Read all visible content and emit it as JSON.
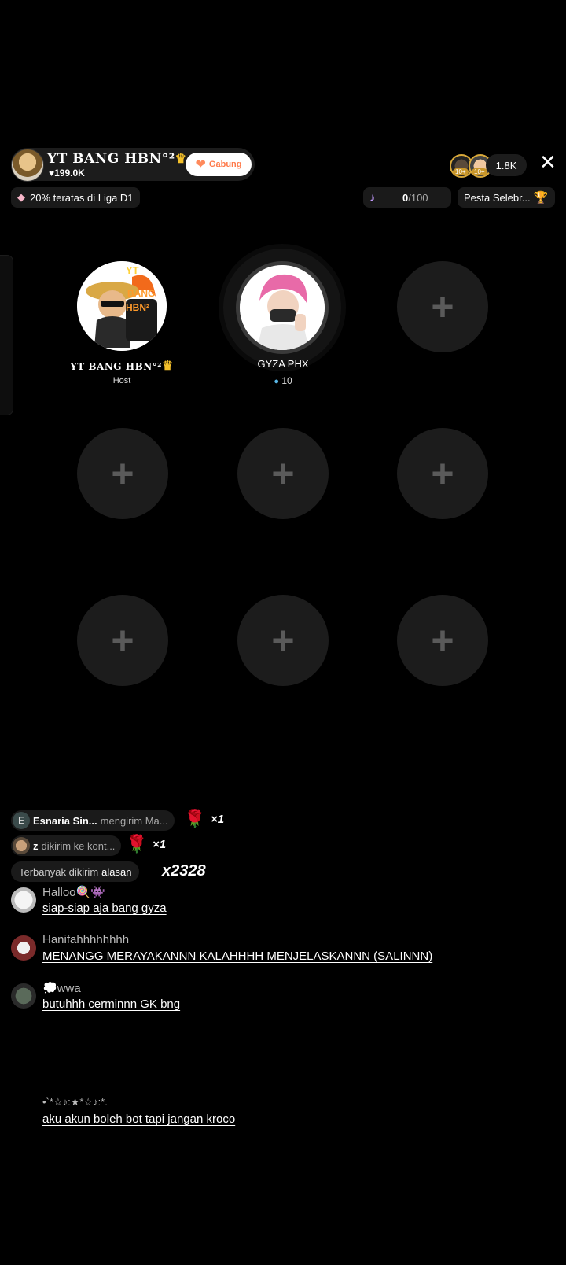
{
  "host_bar": {
    "name": "YT BANG HBN°²",
    "likes": "♥199.0K",
    "join_label": "Gabung",
    "viewer_count": "1.8K",
    "viewer_badge_1": "10+",
    "viewer_badge_2": "10+"
  },
  "league": {
    "text": "20% teratas di Liga D1"
  },
  "score": {
    "current": "0",
    "max": "/100"
  },
  "event": {
    "label": "Pesta Selebr..."
  },
  "seats": {
    "host": {
      "name": "YT BANG HBN°²",
      "role": "Host",
      "badge_line1": "YT",
      "badge_line2": "BANG",
      "badge_line3": "HBN²"
    },
    "guest": {
      "name": "GYZA PHX",
      "coins": "10"
    }
  },
  "gifts": [
    {
      "avatar_letter": "E",
      "user": "Esnaria Sin...",
      "action": "mengirim Ma...",
      "count": "×1"
    },
    {
      "user": "z",
      "action": "dikirim ke kont...",
      "count": "×1"
    }
  ],
  "top_sent": {
    "label": "Terbanyak dikirim",
    "reason": "alasan",
    "count": "x2328"
  },
  "comments": [
    {
      "user": "Halloo🍭👾",
      "text": "siap-siap aja bang gyza"
    },
    {
      "user": "Hanifahhhhhhhh",
      "text": "MENANGG MERAYAKANNN KALAHHHH MENJELASKANNN (SALINNN)"
    },
    {
      "user": "💭wwa",
      "text": "butuhhh cerminnn GK bng"
    },
    {
      "user": "•`*☆♪:★*☆♪:*.",
      "text": "aku akun boleh bot tapi jangan kroco"
    }
  ],
  "colors": {
    "background": "#000000",
    "accent_join": "#ff7a4a",
    "coin": "#5ab8e8",
    "rose": "#e23b5a"
  }
}
